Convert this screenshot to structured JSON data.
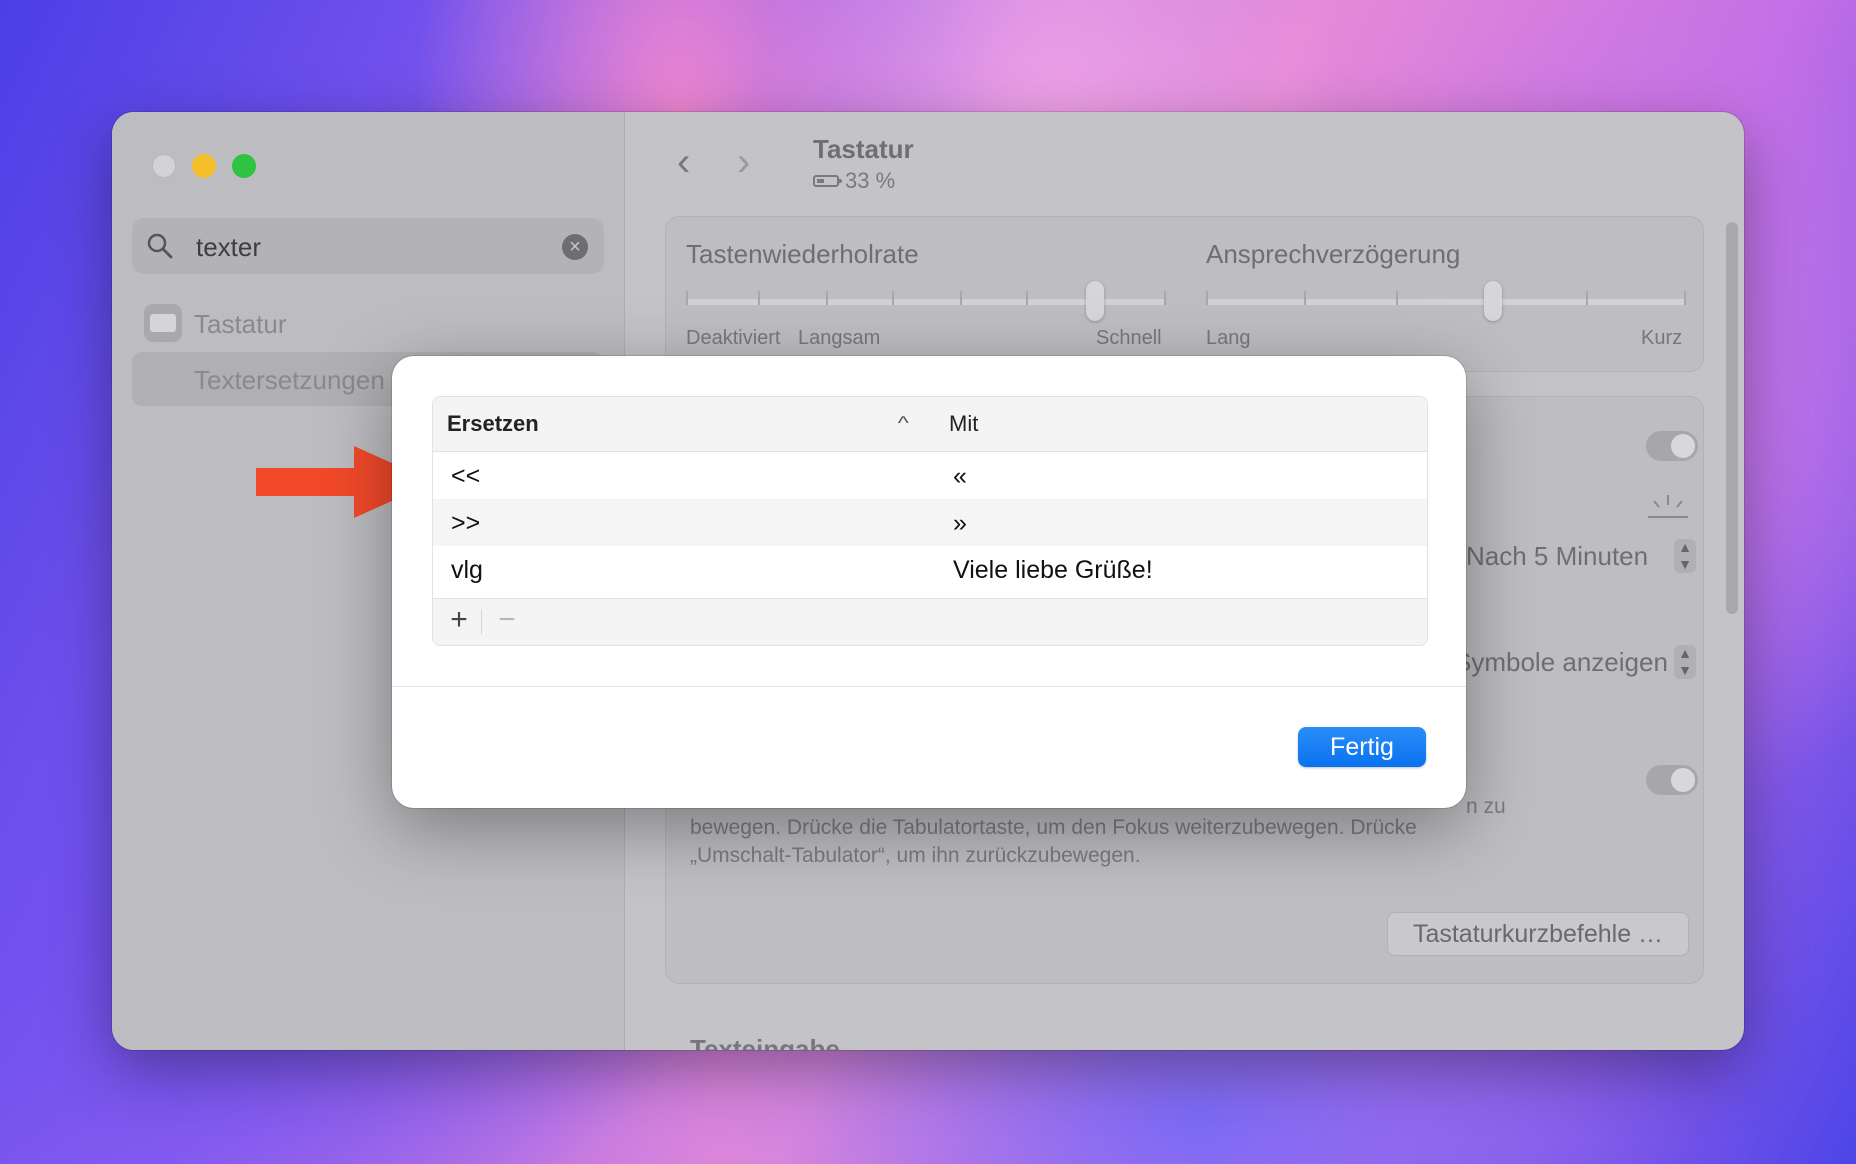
{
  "sidebar": {
    "search": {
      "value": "texter"
    },
    "items": [
      {
        "label": "Tastatur",
        "icon": "keyboard-icon"
      },
      {
        "label": "Textersetzungen …"
      }
    ]
  },
  "header": {
    "title": "Tastatur",
    "battery": "33 %"
  },
  "settings": {
    "repeat_rate": {
      "title": "Tastenwiederholrate",
      "labels": [
        "Deaktiviert",
        "Langsam",
        "Schnell"
      ],
      "level": 0.86
    },
    "delay": {
      "title": "Ansprechverzögerung",
      "labels": [
        "Lang",
        "Kurz"
      ],
      "level": 0.6
    },
    "backlight_off": "Nach 5 Minuten",
    "globe_key": "Symbole anzeigen",
    "focus_description": "bewegen. Drücke die Tabulatortaste, um den Fokus weiterzubewegen. Drücke „Umschalt-Tabulator“, um ihn zurückzubewegen.",
    "focus_fragment": "n zu",
    "shortcuts_button": "Tastaturkurzbefehle …",
    "section_title": "Texteingabe"
  },
  "dialog": {
    "columns": [
      "Ersetzen",
      "Mit"
    ],
    "rows": [
      {
        "replace": "<<",
        "with": "«"
      },
      {
        "replace": ">>",
        "with": "»"
      },
      {
        "replace": "vlg",
        "with": "Viele liebe Grüße!"
      }
    ],
    "add_label": "+",
    "remove_label": "−",
    "done_label": "Fertig"
  },
  "colors": {
    "accent": "#0a72f0",
    "annotation_arrow": "#f2492a"
  }
}
